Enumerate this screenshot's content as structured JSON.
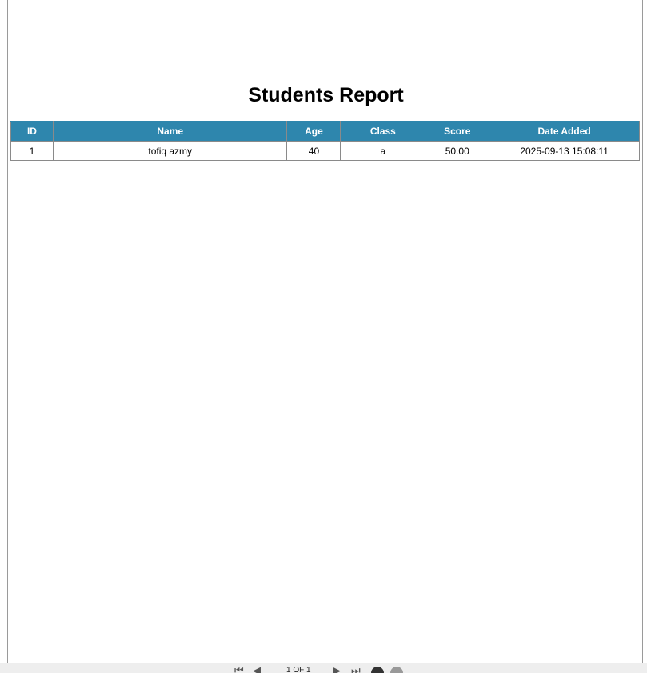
{
  "report": {
    "title": "Students Report"
  },
  "table": {
    "columns": [
      "ID",
      "Name",
      "Age",
      "Class",
      "Score",
      "Date Added"
    ],
    "rows": [
      [
        "1",
        "tofiq azmy",
        "40",
        "a",
        "50.00",
        "2025-09-13 15:08:11"
      ]
    ]
  },
  "toolbar": {
    "page_indicator": "1 OF 1",
    "icons": [
      "first-page-icon",
      "prev-page-icon",
      "next-page-icon",
      "last-page-icon",
      "print-icon",
      "download-icon"
    ]
  },
  "colors": {
    "header_bg": "#2e86ad",
    "header_text": "#ffffff"
  }
}
